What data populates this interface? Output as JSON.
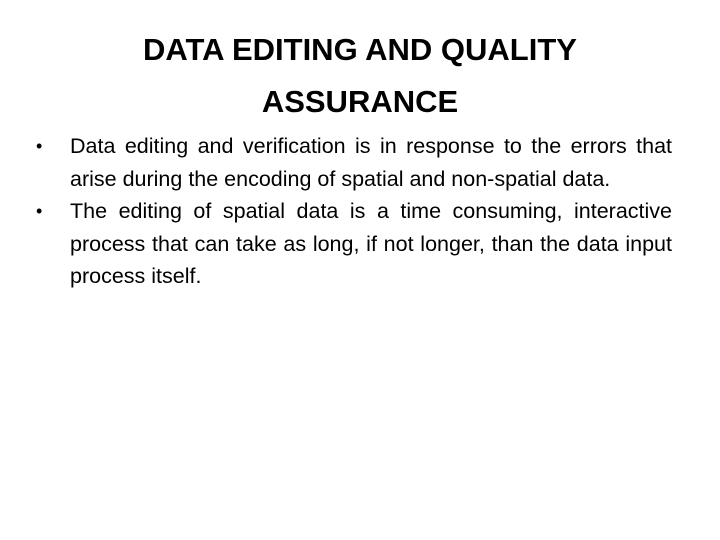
{
  "slide": {
    "title": "DATA EDITING AND QUALITY ASSURANCE",
    "bullet_glyph": "•",
    "bullets": [
      {
        "text": "Data editing and verification is in response to the errors that arise during the encoding of spatial and non-spatial data."
      },
      {
        "text": "The editing of spatial data is a time consuming, interactive process that can take as long, if not longer, than the data input process itself."
      }
    ]
  }
}
